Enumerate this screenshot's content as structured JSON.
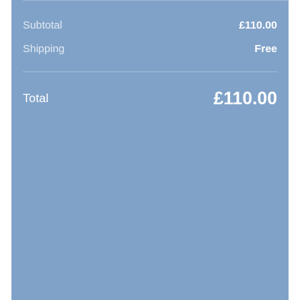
{
  "summary": {
    "subtotal_label": "Subtotal",
    "subtotal_value": "£110.00",
    "shipping_label": "Shipping",
    "shipping_value": "Free",
    "total_label": "Total",
    "total_value": "£110.00"
  },
  "colors": {
    "panel_background": "#80a2c8",
    "text": "#ffffff"
  }
}
